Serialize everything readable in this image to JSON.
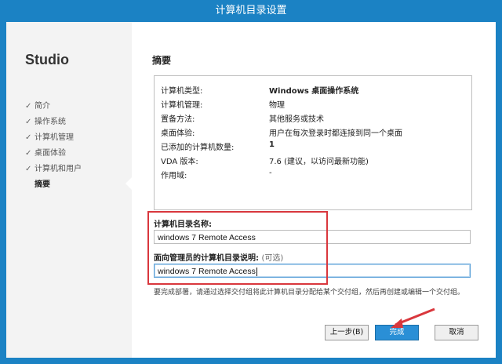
{
  "window": {
    "title": "计算机目录设置"
  },
  "sidebar": {
    "brand": "Studio",
    "steps": [
      {
        "label": "简介",
        "check": "✓"
      },
      {
        "label": "操作系统",
        "check": "✓"
      },
      {
        "label": "计算机管理",
        "check": "✓"
      },
      {
        "label": "桌面体验",
        "check": "✓"
      },
      {
        "label": "计算机和用户",
        "check": "✓"
      },
      {
        "label": "摘要",
        "check": ""
      }
    ]
  },
  "main": {
    "title": "摘要",
    "summary": [
      {
        "key": "计算机类型:",
        "value": "Windows 桌面操作系统"
      },
      {
        "key": "计算机管理:",
        "value": "物理"
      },
      {
        "key": "置备方法:",
        "value": "其他服务或技术"
      },
      {
        "key": "桌面体验:",
        "value": "用户在每次登录时都连接到同一个桌面"
      },
      {
        "key": "已添加的计算机数量:",
        "value": "1"
      },
      {
        "key": "VDA 版本:",
        "value": "7.6 (建议，以访问最新功能)"
      },
      {
        "key": "作用域:",
        "value": "-"
      }
    ],
    "catalog_name_label": "计算机目录名称:",
    "catalog_name_value": "windows 7 Remote Access",
    "description_label": "面向管理员的计算机目录说明:",
    "description_optional": "(可选)",
    "description_value": "windows 7 Remote Access",
    "note": "要完成部署，请通过选择交付组将此计算机目录分配给某个交付组，然后再创建或编辑一个交付组。"
  },
  "buttons": {
    "back": "上一步(B)",
    "finish": "完成",
    "cancel": "取消"
  },
  "colors": {
    "titlebar": "#1b82c4",
    "primary_button": "#2a8fd6",
    "annotation_red": "#d9373d"
  }
}
